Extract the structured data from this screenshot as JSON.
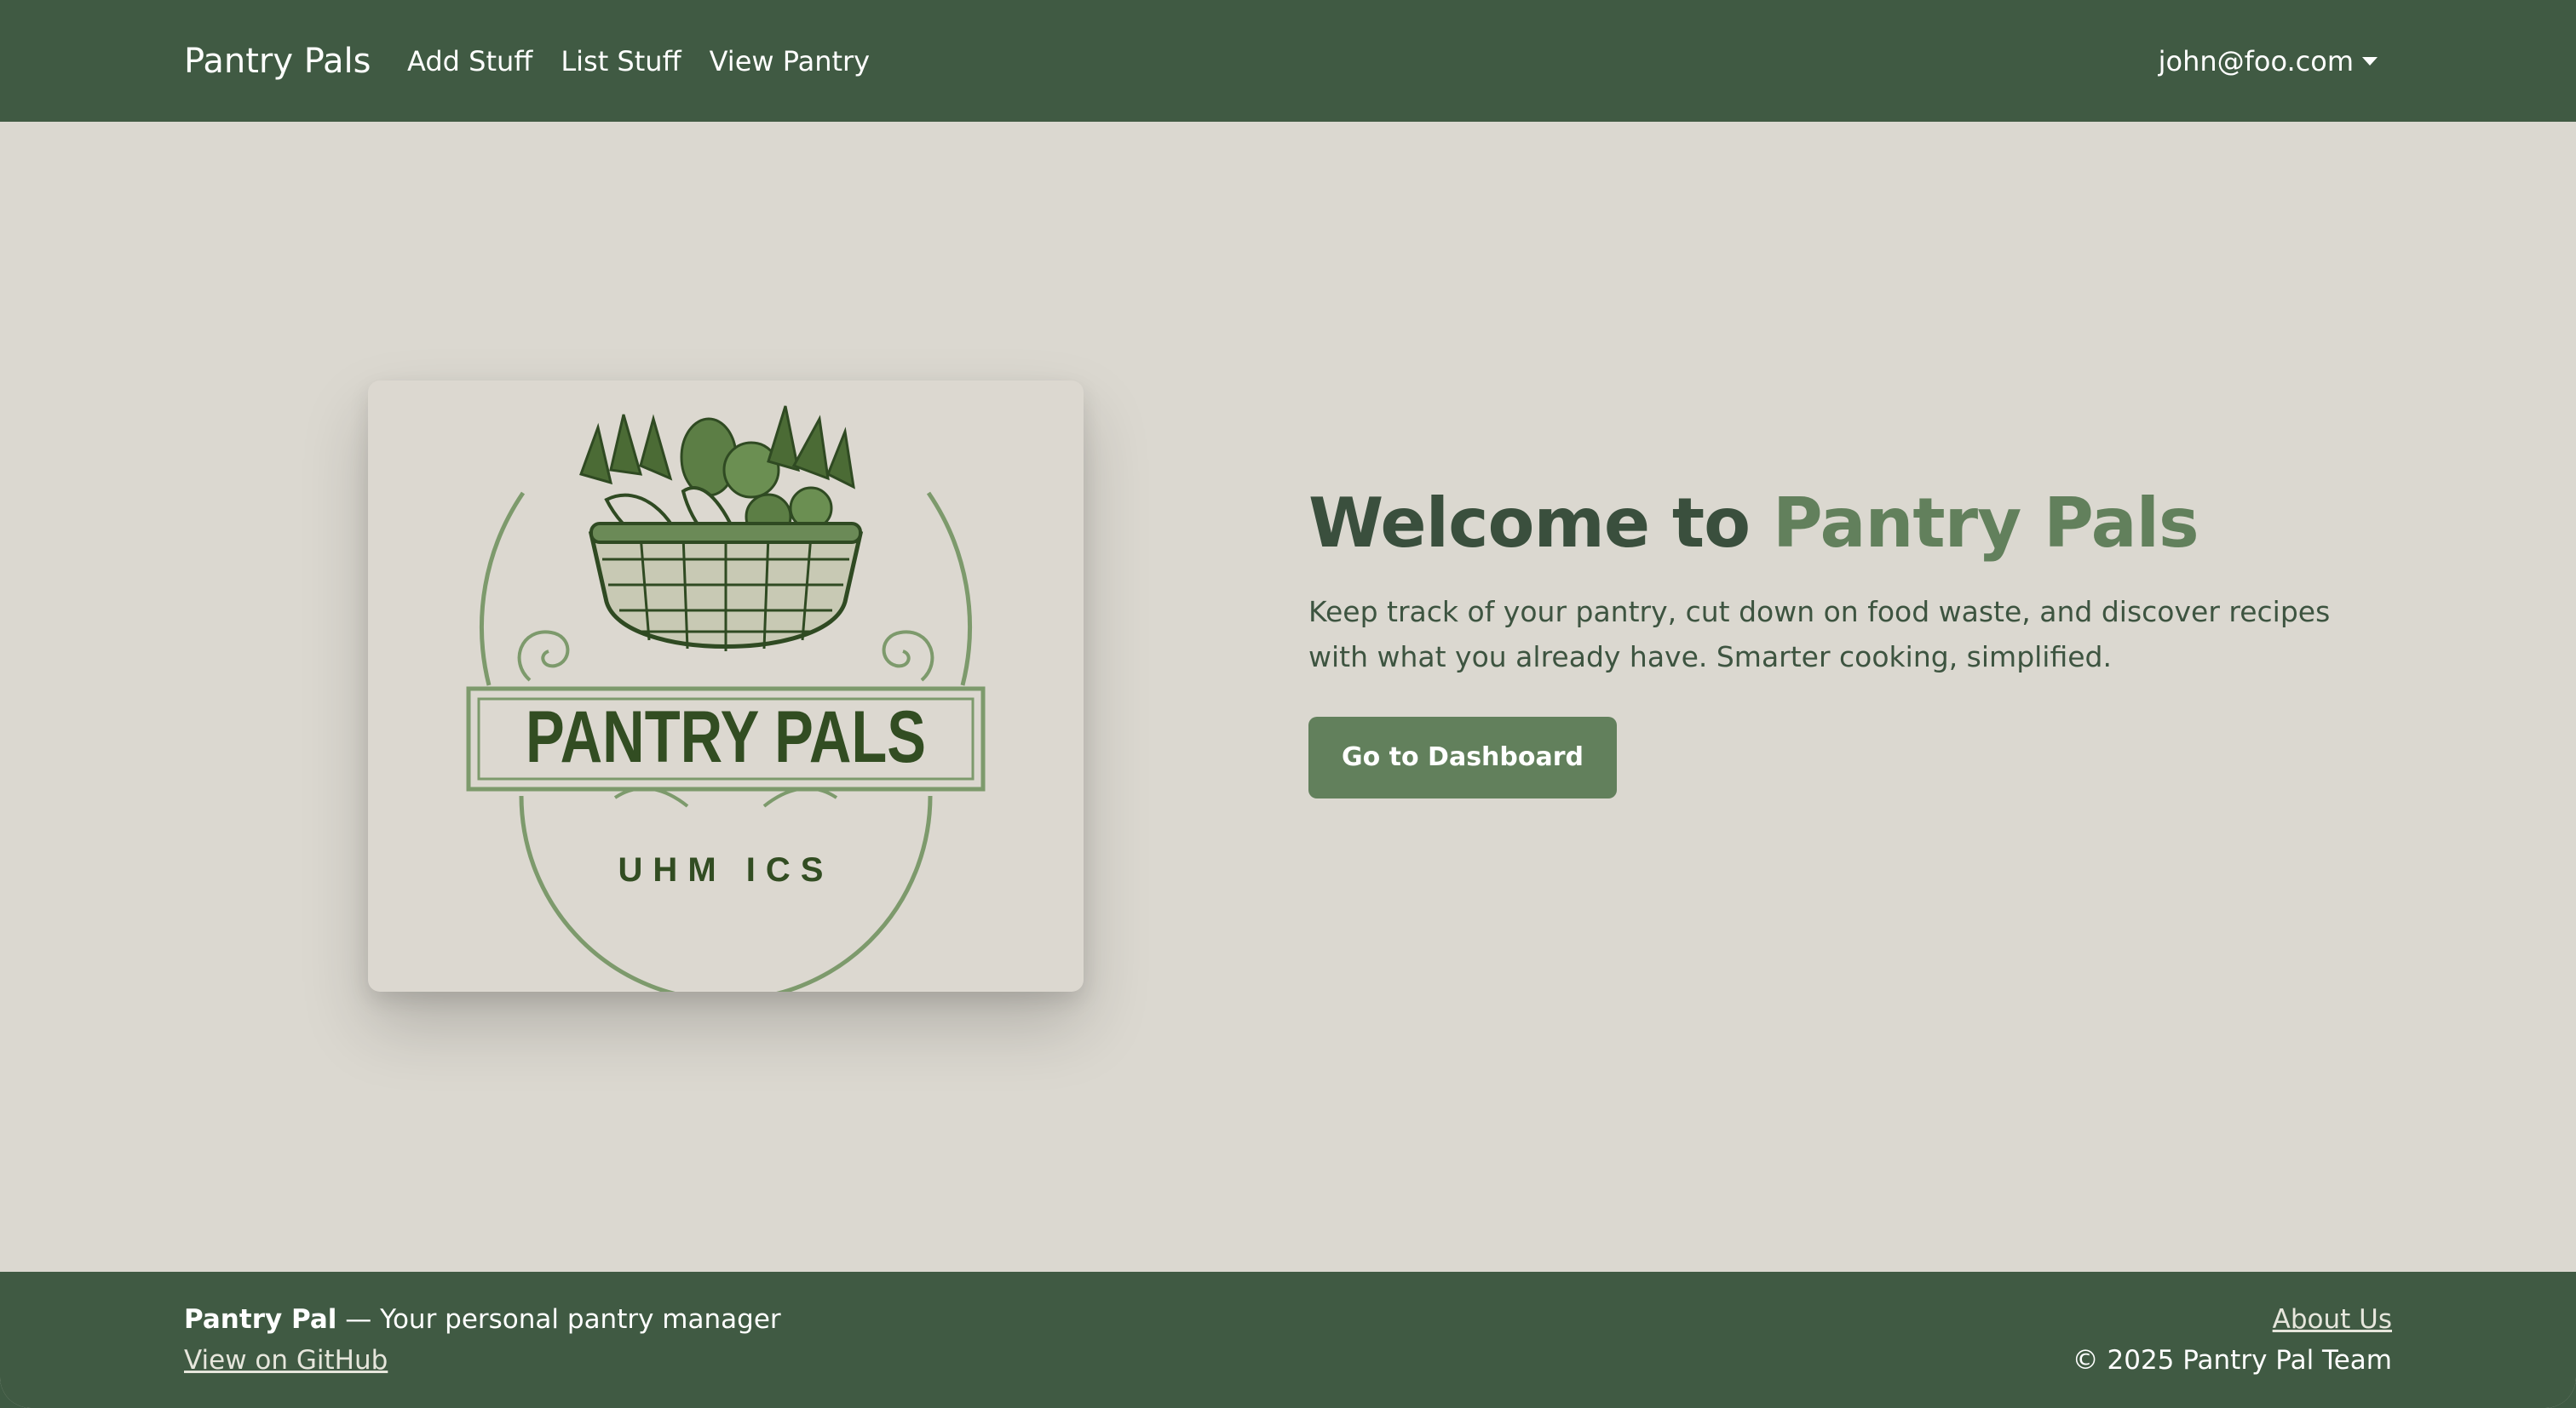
{
  "navbar": {
    "brand": "Pantry Pals",
    "links": [
      "Add Stuff",
      "List Stuff",
      "View Pantry"
    ],
    "user_email": "john@foo.com"
  },
  "hero": {
    "title_prefix": "Welcome to ",
    "title_accent": "Pantry Pals",
    "description": "Keep track of your pantry, cut down on food waste, and discover recipes with what you already have. Smarter cooking, simplified.",
    "cta_label": "Go to Dashboard"
  },
  "logo": {
    "banner_text": "PANTRY PALS",
    "sub_text": "UHM ICS"
  },
  "footer": {
    "brand": "Pantry Pal",
    "tagline": " — Your personal pantry manager",
    "github_link": "View on GitHub",
    "about_link": "About Us",
    "copyright": "© 2025 Pantry Pal Team"
  },
  "colors": {
    "nav_bg": "#405a43",
    "page_bg": "#dbd8d0",
    "accent": "#62805c",
    "title_dark": "#3a4f3d"
  }
}
